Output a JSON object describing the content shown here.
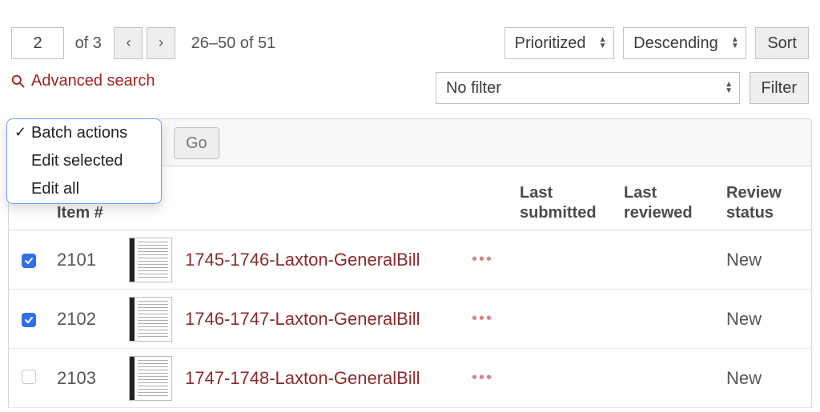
{
  "pagination": {
    "page_input": "2",
    "of_label": "of 3",
    "range_label": "26–50 of 51"
  },
  "sort": {
    "field": "Prioritized",
    "direction": "Descending",
    "button": "Sort"
  },
  "advanced_search_label": "Advanced search",
  "filter": {
    "selected": "No filter",
    "button": "Filter"
  },
  "batch": {
    "go_label": "Go",
    "options": [
      {
        "label": "Batch actions",
        "selected": true
      },
      {
        "label": "Edit selected",
        "selected": false
      },
      {
        "label": "Edit all",
        "selected": false
      }
    ]
  },
  "headers": {
    "item": "Item #",
    "last_submitted": "Last submitted",
    "last_reviewed": "Last reviewed",
    "review_status": "Review status"
  },
  "rows": [
    {
      "checked": true,
      "item": "2101",
      "title": "1745-1746-Laxton-GeneralBill",
      "status": "New"
    },
    {
      "checked": true,
      "item": "2102",
      "title": "1746-1747-Laxton-GeneralBill",
      "status": "New"
    },
    {
      "checked": false,
      "item": "2103",
      "title": "1747-1748-Laxton-GeneralBill",
      "status": "New"
    }
  ]
}
